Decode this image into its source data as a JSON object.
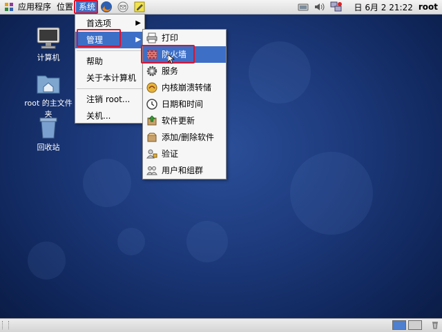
{
  "top_panel": {
    "menus": {
      "applications": "应用程序",
      "places": "位置",
      "system": "系统"
    },
    "launchers": [
      "firefox-icon",
      "mail-icon",
      "notes-icon"
    ],
    "tray": [
      "network-icon",
      "volume-icon",
      "network-status-icon"
    ],
    "clock": "日 6月  2 21:22",
    "user": "root"
  },
  "desktop_icons": [
    {
      "label": "计算机",
      "icon": "computer-icon"
    },
    {
      "label": "root 的主文件夹",
      "icon": "home-folder-icon"
    },
    {
      "label": "回收站",
      "icon": "trash-icon"
    }
  ],
  "system_menu": {
    "items": [
      {
        "label": "首选项",
        "submenu": true
      },
      {
        "label": "管理",
        "submenu": true,
        "selected": true
      },
      {
        "label": "帮助"
      },
      {
        "label": "关于本计算机"
      },
      {
        "label": "注销 root..."
      },
      {
        "label": "关机..."
      }
    ]
  },
  "admin_submenu": {
    "items": [
      {
        "label": "打印",
        "icon": "printer-icon"
      },
      {
        "label": "防火墙",
        "icon": "firewall-icon",
        "selected": true
      },
      {
        "label": "服务",
        "icon": "services-gear-icon"
      },
      {
        "label": "内核崩溃转储",
        "icon": "kernel-dump-icon"
      },
      {
        "label": "日期和时间",
        "icon": "clock-icon"
      },
      {
        "label": "软件更新",
        "icon": "software-update-icon"
      },
      {
        "label": "添加/删除软件",
        "icon": "add-remove-software-icon"
      },
      {
        "label": "验证",
        "icon": "authentication-icon"
      },
      {
        "label": "用户和组群",
        "icon": "users-groups-icon"
      }
    ]
  },
  "colors": {
    "selection": "#3d6fc7",
    "highlight": "#e0102a"
  }
}
